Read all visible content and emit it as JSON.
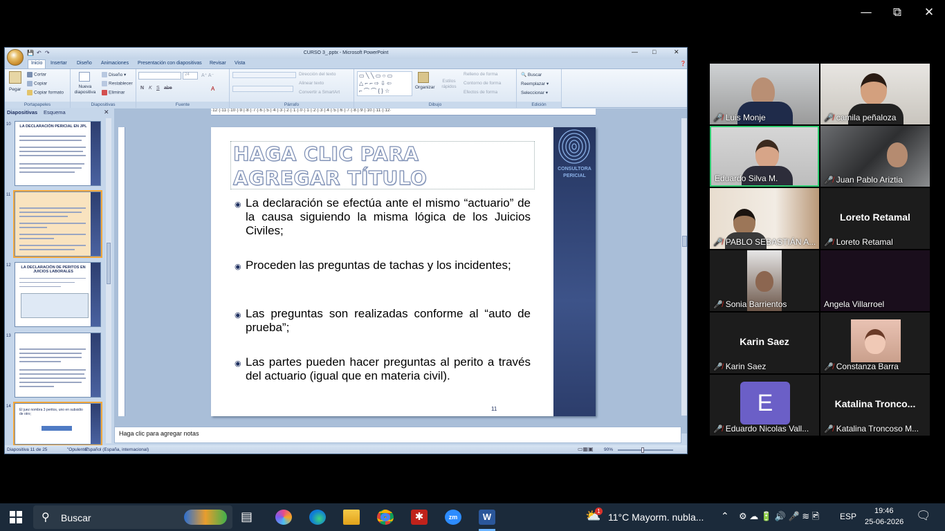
{
  "ppt": {
    "title": "CURSO 3_.pptx - Microsoft PowerPoint",
    "tabs": [
      "Inicio",
      "Insertar",
      "Diseño",
      "Animaciones",
      "Presentación con diapositivas",
      "Revisar",
      "Vista"
    ],
    "ribbon": {
      "portapapeles": {
        "paste": "Pegar",
        "cut": "Cortar",
        "copy": "Copiar",
        "format": "Copiar formato",
        "label": "Portapapeles"
      },
      "diapositivas": {
        "new": "Nueva diapositiva",
        "design": "Diseño",
        "reset": "Restablecer",
        "delete": "Eliminar",
        "label": "Diapositivas"
      },
      "fuente": {
        "size": "24",
        "label": "Fuente"
      },
      "parrafo": {
        "direction": "Dirección del texto",
        "align": "Alinear texto",
        "smartart": "Convertir a SmartArt",
        "label": "Párrafo"
      },
      "dibujo": {
        "organize": "Organizar",
        "styles": "Estilos rápidos",
        "fill": "Relleno de forma",
        "outline": "Contorno de forma",
        "effects": "Efectos de forma",
        "label": "Dibujo"
      },
      "edicion": {
        "find": "Buscar",
        "replace": "Reemplazar",
        "select": "Seleccionar",
        "label": "Edición"
      }
    },
    "pane_tabs": [
      "Diapositivas",
      "Esquema"
    ],
    "thumbnails": [
      {
        "num": "10",
        "title": "LA DECLARACIÓN PERICIAL EN JPL"
      },
      {
        "num": "11",
        "title": ""
      },
      {
        "num": "12",
        "title": "LA DECLARACIÓN DE PERITOS EN JUICIOS LABORALES"
      },
      {
        "num": "13",
        "title": ""
      },
      {
        "num": "14",
        "title": ""
      }
    ],
    "thumb14_text": "El juez nombra 3 peritos, uno en subsidio de otro;",
    "ruler": "·12·|·11·|·10·|·9·|·8·|·7·|·6·|·5·|·4·|·3·|·2·|·1·|·0·|·1·|·2·|·3·|·4·|·5·|·6·|·7·|·8·|·9·|·10·|·11·|·12·",
    "slide": {
      "title": "HAGA CLIC PARA AGREGAR TÍTULO",
      "bullets": [
        "La declaración se efectúa ante el mismo “actuario” de la causa siguiendo la misma lógica de los Juicios Civiles;",
        "Proceden las preguntas de tachas y los incidentes;",
        "Las preguntas son realizadas conforme al “auto de prueba”;",
        "Las partes pueden hacer preguntas al perito a través del actuario (igual que en materia civil)."
      ],
      "page_number": "11",
      "logo_text": "CONSULTORA PERICIAL"
    },
    "notes": "Haga clic para agregar notas",
    "status": {
      "slide": "Diapositiva 11 de 25",
      "theme": "\"Opulento\"",
      "lang": "Español (España, internacional)",
      "zoom": "90%"
    }
  },
  "participants": [
    {
      "name": "Luis Monje",
      "video": true
    },
    {
      "name": "camila peñaloza",
      "video": true
    },
    {
      "name": "Eduardo Silva M.",
      "video": true,
      "active": true
    },
    {
      "name": "Juan Pablo Ariztia",
      "video": true
    },
    {
      "name": "PABLO SEBASTIÁN A...",
      "video": true
    },
    {
      "name": "Loreto Retamal",
      "video": false,
      "big": "Loreto Retamal"
    },
    {
      "name": "Sonia Barrientos",
      "video": true
    },
    {
      "name": "Angela Villarroel",
      "video": false
    },
    {
      "name": "Karin Saez",
      "video": false,
      "big": "Karin Saez"
    },
    {
      "name": "Constanza Barra",
      "video": true
    },
    {
      "name": "Eduardo Nicolas Vall...",
      "video": false,
      "initial": "E"
    },
    {
      "name": "Katalina Troncoso M...",
      "video": false,
      "big": "Katalina  Tronco..."
    }
  ],
  "taskbar": {
    "search": "Buscar",
    "weather": "11°C  Mayorm. nubla...",
    "weather_badge": "1",
    "lang": "ESP",
    "time": "19:46",
    "date": "25-06-2026"
  },
  "colors": {
    "accent_title": "#7b8db3",
    "slide_band": "#2d3e70",
    "active_border": "#2ecc71"
  }
}
